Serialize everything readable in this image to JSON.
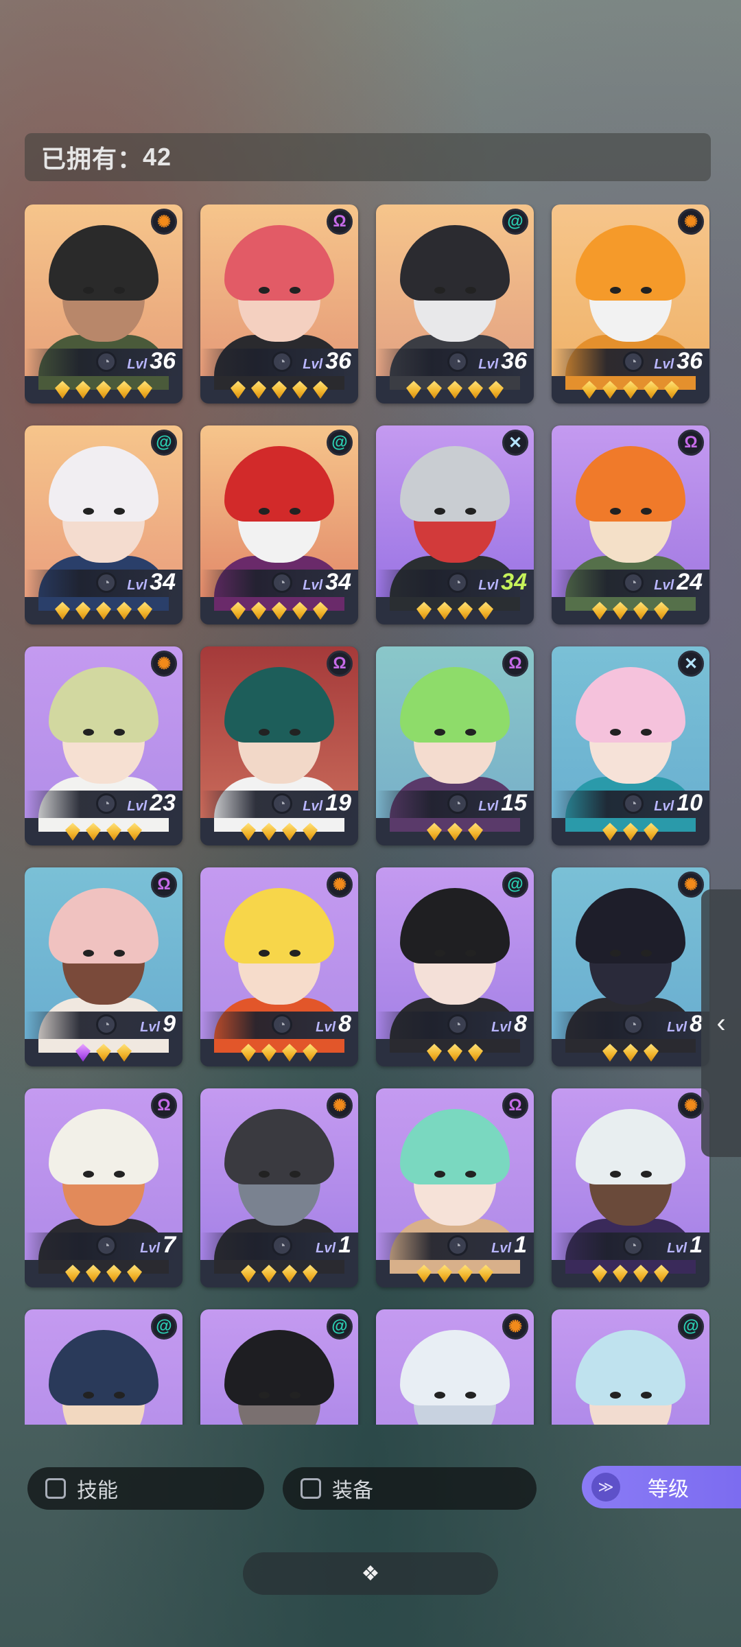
{
  "owned": {
    "label": "已拥有：",
    "count": "42"
  },
  "level_label": "Lvl",
  "heroes": [
    {
      "level": "36",
      "stars": 5,
      "purple_stars": 0,
      "faction_icon": "sun-icon",
      "faction_glyph": "✺",
      "faction_color": "#f28a1a",
      "bg_top": "#f6c58b",
      "bg_bottom": "#e7a17a",
      "hair": "#2a2a2a",
      "skin": "#b8876a",
      "cloth": "#4a5a3a",
      "level_highlight": false
    },
    {
      "level": "36",
      "stars": 5,
      "purple_stars": 0,
      "faction_icon": "omega-icon",
      "faction_glyph": "Ω",
      "faction_color": "#c66be8",
      "bg_top": "#f6c58b",
      "bg_bottom": "#e59a78",
      "hair": "#e25b66",
      "skin": "#f4d0c0",
      "cloth": "#2a2a2e",
      "level_highlight": false
    },
    {
      "level": "36",
      "stars": 5,
      "purple_stars": 0,
      "faction_icon": "swirl-icon",
      "faction_glyph": "@",
      "faction_color": "#2bd1b4",
      "bg_top": "#f6c58b",
      "bg_bottom": "#e3a283",
      "hair": "#2b2b30",
      "skin": "#e8e8ea",
      "cloth": "#3b3d44",
      "level_highlight": false
    },
    {
      "level": "36",
      "stars": 5,
      "purple_stars": 0,
      "faction_icon": "sun-icon",
      "faction_glyph": "✺",
      "faction_color": "#f28a1a",
      "bg_top": "#f6c58b",
      "bg_bottom": "#f0b36a",
      "hair": "#f59a2a",
      "skin": "#f2f2f2",
      "cloth": "#e4902d",
      "level_highlight": false
    },
    {
      "level": "34",
      "stars": 5,
      "purple_stars": 0,
      "faction_icon": "swirl-icon",
      "faction_glyph": "@",
      "faction_color": "#2bd1b4",
      "bg_top": "#f6c58b",
      "bg_bottom": "#ea9f7e",
      "hair": "#f1eef2",
      "skin": "#f4dccf",
      "cloth": "#2a3f6a",
      "level_highlight": false
    },
    {
      "level": "34",
      "stars": 5,
      "purple_stars": 0,
      "faction_icon": "swirl-icon",
      "faction_glyph": "@",
      "faction_color": "#2bd1b4",
      "bg_top": "#f6c58b",
      "bg_bottom": "#e28a6a",
      "hair": "#d22a2a",
      "skin": "#f2f2f2",
      "cloth": "#6a2a6a",
      "level_highlight": false
    },
    {
      "level": "34",
      "stars": 4,
      "purple_stars": 0,
      "faction_icon": "cross-icon",
      "faction_glyph": "✕",
      "faction_color": "#b5e4ff",
      "bg_top": "#c49af0",
      "bg_bottom": "#9a74e4",
      "hair": "#c9cdd2",
      "skin": "#d23a3a",
      "cloth": "#2a2e32",
      "level_highlight": true
    },
    {
      "level": "24",
      "stars": 4,
      "purple_stars": 0,
      "faction_icon": "omega-icon",
      "faction_glyph": "Ω",
      "faction_color": "#c66be8",
      "bg_top": "#c49af0",
      "bg_bottom": "#a27ae2",
      "hair": "#f07a2a",
      "skin": "#f4e0c8",
      "cloth": "#55704a",
      "level_highlight": false
    },
    {
      "level": "23",
      "stars": 4,
      "purple_stars": 0,
      "faction_icon": "sun-icon",
      "faction_glyph": "✺",
      "faction_color": "#f28a1a",
      "bg_top": "#c49af0",
      "bg_bottom": "#b28ee8",
      "hair": "#d2d8a0",
      "skin": "#f6e0d2",
      "cloth": "#f2f2f0",
      "level_highlight": false
    },
    {
      "level": "19",
      "stars": 4,
      "purple_stars": 0,
      "faction_icon": "omega-icon",
      "faction_glyph": "Ω",
      "faction_color": "#c66be8",
      "bg_top": "#a53a3a",
      "bg_bottom": "#c86a5a",
      "hair": "#1d5e5a",
      "skin": "#f2d8c8",
      "cloth": "#f2f2f2",
      "level_highlight": false
    },
    {
      "level": "15",
      "stars": 3,
      "purple_stars": 0,
      "faction_icon": "omega-icon",
      "faction_glyph": "Ω",
      "faction_color": "#c66be8",
      "bg_top": "#8ac7c9",
      "bg_bottom": "#78b0c9",
      "hair": "#8edc6a",
      "skin": "#f4dccf",
      "cloth": "#5a3a6a",
      "level_highlight": false
    },
    {
      "level": "10",
      "stars": 3,
      "purple_stars": 0,
      "faction_icon": "cross-icon",
      "faction_glyph": "✕",
      "faction_color": "#b5e4ff",
      "bg_top": "#7ac0d6",
      "bg_bottom": "#6ab0d0",
      "hair": "#f5c2dc",
      "skin": "#f6e2d8",
      "cloth": "#2a9aaa",
      "level_highlight": false
    },
    {
      "level": "9",
      "stars": 2,
      "purple_stars": 1,
      "faction_icon": "omega-icon",
      "faction_glyph": "Ω",
      "faction_color": "#c66be8",
      "bg_top": "#7ac0d6",
      "bg_bottom": "#6aaed0",
      "hair": "#f0c2c0",
      "skin": "#7a4a3a",
      "cloth": "#f0e8e0",
      "level_highlight": false
    },
    {
      "level": "8",
      "stars": 4,
      "purple_stars": 0,
      "faction_icon": "sun-icon",
      "faction_glyph": "✺",
      "faction_color": "#f28a1a",
      "bg_top": "#c49af0",
      "bg_bottom": "#b28ee8",
      "hair": "#f7d64a",
      "skin": "#f6dccb",
      "cloth": "#e2562a",
      "level_highlight": false
    },
    {
      "level": "8",
      "stars": 3,
      "purple_stars": 0,
      "faction_icon": "swirl-icon",
      "faction_glyph": "@",
      "faction_color": "#2bd1b4",
      "bg_top": "#c49af0",
      "bg_bottom": "#a582e6",
      "hair": "#1f1f22",
      "skin": "#f4e0d8",
      "cloth": "#2a2a30",
      "level_highlight": false
    },
    {
      "level": "8",
      "stars": 3,
      "purple_stars": 0,
      "faction_icon": "sun-icon",
      "faction_glyph": "✺",
      "faction_color": "#f28a1a",
      "bg_top": "#7ac0d6",
      "bg_bottom": "#6aaed0",
      "hair": "#1e1e2a",
      "skin": "#2a2a3a",
      "cloth": "#2a2a30",
      "level_highlight": false
    },
    {
      "level": "7",
      "stars": 4,
      "purple_stars": 0,
      "faction_icon": "omega-icon",
      "faction_glyph": "Ω",
      "faction_color": "#c66be8",
      "bg_top": "#c49af0",
      "bg_bottom": "#b08be8",
      "hair": "#f2f0e8",
      "skin": "#e28a5a",
      "cloth": "#2a2a30",
      "level_highlight": false
    },
    {
      "level": "1",
      "stars": 4,
      "purple_stars": 0,
      "faction_icon": "sun-icon",
      "faction_glyph": "✺",
      "faction_color": "#f28a1a",
      "bg_top": "#c49af0",
      "bg_bottom": "#a582e6",
      "hair": "#3a3a40",
      "skin": "#7a8290",
      "cloth": "#2a2a30",
      "level_highlight": false
    },
    {
      "level": "1",
      "stars": 4,
      "purple_stars": 0,
      "faction_icon": "omega-icon",
      "faction_glyph": "Ω",
      "faction_color": "#c66be8",
      "bg_top": "#c49af0",
      "bg_bottom": "#b08be8",
      "hair": "#7ad8c0",
      "skin": "#f6e2d8",
      "cloth": "#d8b08a",
      "level_highlight": false
    },
    {
      "level": "1",
      "stars": 4,
      "purple_stars": 0,
      "faction_icon": "sun-icon",
      "faction_glyph": "✺",
      "faction_color": "#f28a1a",
      "bg_top": "#c49af0",
      "bg_bottom": "#a582e6",
      "hair": "#e8eef0",
      "skin": "#6a4a3a",
      "cloth": "#3a2a5a",
      "level_highlight": false
    },
    {
      "level": "",
      "stars": 0,
      "purple_stars": 0,
      "faction_icon": "swirl-icon",
      "faction_glyph": "@",
      "faction_color": "#2bd1b4",
      "bg_top": "#c49af0",
      "bg_bottom": "#b08be8",
      "hair": "#2a3a5a",
      "skin": "#f2d8c0",
      "cloth": "#2a2a40",
      "level_highlight": false
    },
    {
      "level": "",
      "stars": 0,
      "purple_stars": 0,
      "faction_icon": "swirl-icon",
      "faction_glyph": "@",
      "faction_color": "#2bd1b4",
      "bg_top": "#c49af0",
      "bg_bottom": "#a582e6",
      "hair": "#1e1e22",
      "skin": "#7a7070",
      "cloth": "#2a2a30",
      "level_highlight": false
    },
    {
      "level": "",
      "stars": 0,
      "purple_stars": 0,
      "faction_icon": "sun-icon",
      "faction_glyph": "✺",
      "faction_color": "#f28a1a",
      "bg_top": "#c49af0",
      "bg_bottom": "#b08be8",
      "hair": "#e8eef4",
      "skin": "#c8d2e0",
      "cloth": "#8a9ab0",
      "level_highlight": false
    },
    {
      "level": "",
      "stars": 0,
      "purple_stars": 0,
      "faction_icon": "swirl-icon",
      "faction_glyph": "@",
      "faction_color": "#2bd1b4",
      "bg_top": "#c49af0",
      "bg_bottom": "#a582e6",
      "hair": "#bfe2ee",
      "skin": "#f2dcd0",
      "cloth": "#2a3a5a",
      "level_highlight": false
    }
  ],
  "filters": {
    "skill_label": "技能",
    "equipment_label": "装备",
    "sort_label": "等级",
    "sort_icon_glyph": "≫"
  },
  "collapse_glyph": "❖",
  "side_handle_glyph": "‹"
}
